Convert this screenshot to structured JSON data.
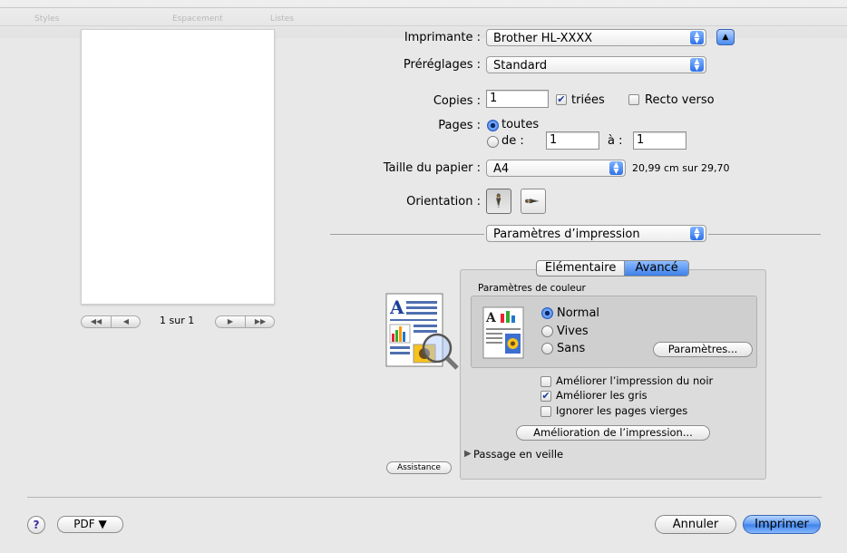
{
  "toolbar_ghost": {
    "items": [
      "Styles",
      "Espacement",
      "Listes"
    ]
  },
  "printer": {
    "label": "Imprimante :",
    "value": "Brother HL-XXXX"
  },
  "presets": {
    "label": "Préréglages :",
    "value": "Standard"
  },
  "copies": {
    "label": "Copies :",
    "value": "1",
    "collated_label": "triées",
    "collated_checked": true,
    "duplex_label": "Recto verso",
    "duplex_checked": false
  },
  "pages": {
    "label": "Pages :",
    "all_label": "toutes",
    "from_label": "de :",
    "from_value": "1",
    "to_label": "à :",
    "to_value": "1",
    "selected": "all"
  },
  "paper": {
    "label": "Taille du papier :",
    "value": "A4",
    "dimensions": "20,99 cm sur 29,70"
  },
  "orientation": {
    "label": "Orientation :",
    "selected": "portrait"
  },
  "section": {
    "value": "Paramètres d’impression"
  },
  "preview_nav": {
    "first": "◀◀",
    "prev": "◀",
    "page_text": "1 sur 1",
    "next": "▶",
    "last": "▶▶"
  },
  "tabs": [
    {
      "label": "Elémentaire",
      "selected": false
    },
    {
      "label": "Avancé",
      "selected": true
    }
  ],
  "color": {
    "group_label": "Paramètres de couleur",
    "options": [
      "Normal",
      "Vives",
      "Sans"
    ],
    "selected": "Normal",
    "settings_button": "Paramètres..."
  },
  "options": {
    "improve_black_label": "Améliorer l’impression du noir",
    "improve_black_checked": false,
    "improve_gray_label": "Améliorer les gris",
    "improve_gray_checked": true,
    "skip_blank_label": "Ignorer les pages vierges",
    "skip_blank_checked": false,
    "improve_print_button": "Amélioration de l’impression...",
    "sleep_label": "Passage en veille"
  },
  "assist_button": "Assistance",
  "footer": {
    "help": "?",
    "pdf_button": "PDF ▼",
    "cancel_button": "Annuler",
    "print_button": "Imprimer"
  },
  "colors": {
    "accent": "#3e80e8",
    "window_bg": "#e8e8e8"
  }
}
